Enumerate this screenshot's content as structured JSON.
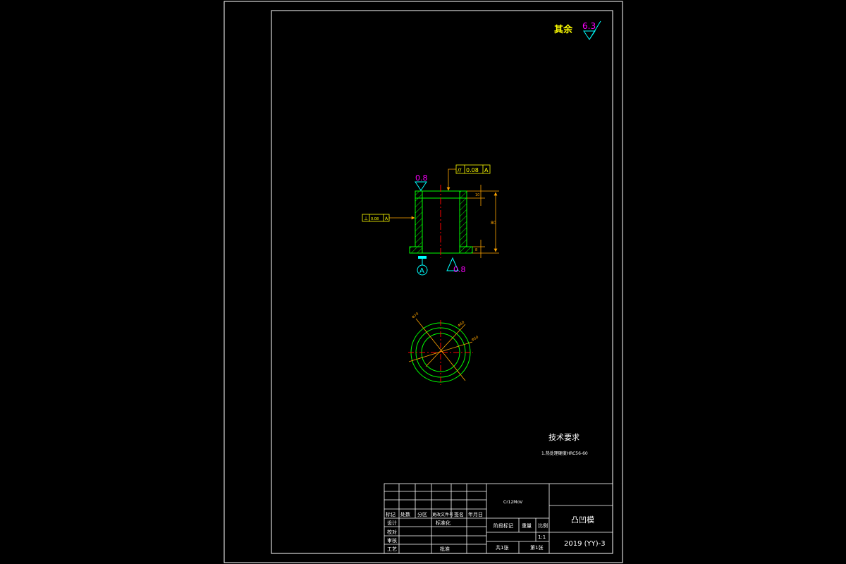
{
  "roughness_general": {
    "label": "其余",
    "value": "6.3"
  },
  "roughness_top": "0.8",
  "roughness_bottom": "0.8",
  "geo_tol_top": {
    "symbol": "//",
    "value": "0.08",
    "datum": "A"
  },
  "geo_tol_left": {
    "symbol": "⊥",
    "value": "0.08",
    "datum": "A"
  },
  "datum_label": "A",
  "tech_req": {
    "title": "技术要求",
    "item1": "1.热处理硬度HRC56-60"
  },
  "title_block": {
    "material": "Cr12MoV",
    "part_name": "凸凹模",
    "drawing_no": "2019 (YY)-3",
    "scale": "1:1",
    "rev_headers": [
      "标记",
      "处数",
      "分区",
      "更改文件号",
      "签名",
      "年月日"
    ],
    "roles": [
      "设计",
      "审核",
      "工艺"
    ],
    "std_label": "标准化",
    "approve_label": "批准",
    "proofread": "校对",
    "stage_label": "阶段标记",
    "weight_label": "重量",
    "scale_label": "比例",
    "sheets_total": "共1张",
    "sheet_no": "第1张"
  },
  "colors": {
    "frame": "#ffffff",
    "outline": "#00ff00",
    "hatch": "#00ff00",
    "center": "#ff0000",
    "dimension": "#ffa500",
    "roughness": "#ff00ff",
    "roughness_symbol": "#00ffff",
    "datum": "#00ffff",
    "annotation": "#ffff00",
    "text": "#ffffff"
  }
}
